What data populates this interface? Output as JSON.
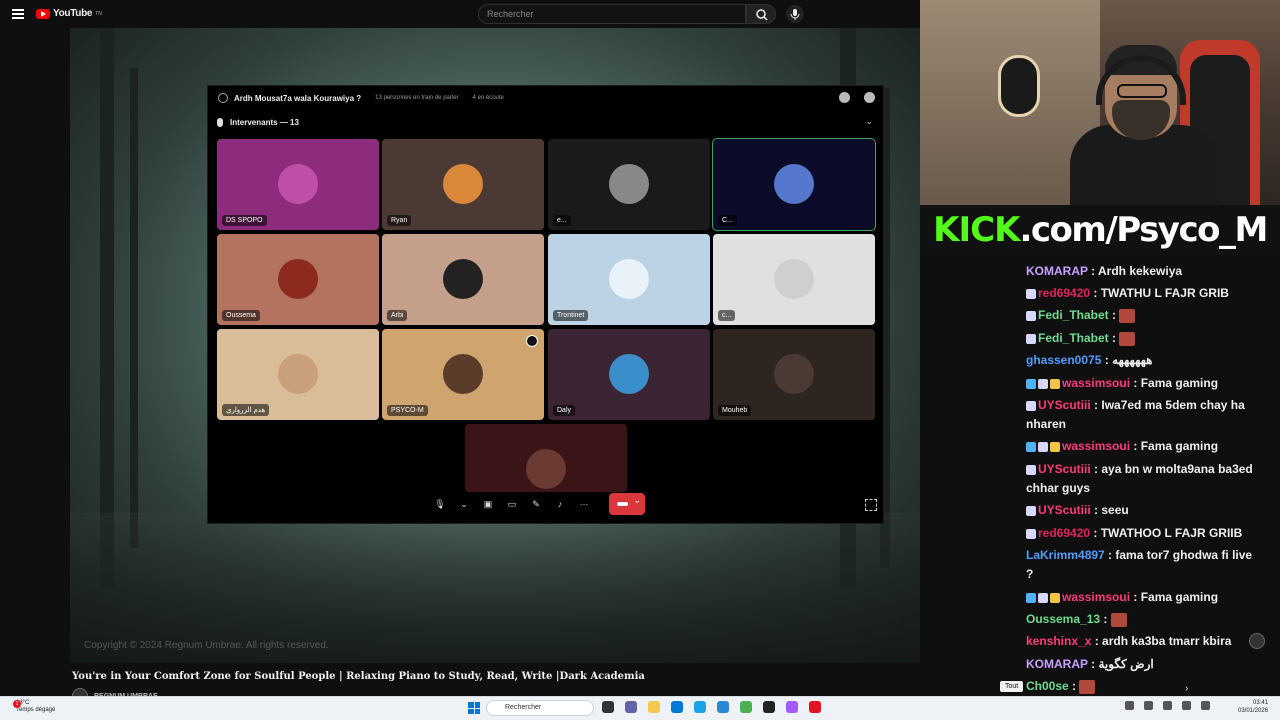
{
  "youtube": {
    "brand": "YouTube",
    "brand_suffix": "TN",
    "search_placeholder": "Rechercher",
    "video_title": "You're in Your Comfort Zone for Soulful People | Relaxing Piano to Study, Read, Write |Dark Academia",
    "channel_name": "REGNUM UMBRAE",
    "copyright": "Copyright © 2024 Regnum Umbrae. All rights reserved."
  },
  "discord": {
    "stage_title": "Ardh Mousat7a wala Kourawiya ?",
    "speaking_count": "13 personnes en train de parler",
    "listening_count": "4 en écoute",
    "speakers_header": "Intervenants — 13",
    "tiles": [
      {
        "name": "DS SPOPO",
        "bg": "#8d2b7c",
        "face": "#c04fa8"
      },
      {
        "name": "Ryan",
        "bg": "#4a3a33",
        "face": "#d9883a"
      },
      {
        "name": "e...",
        "bg": "#1a1a1c",
        "face": "#888888"
      },
      {
        "name": "C...",
        "bg": "#0b0b2a",
        "face": "#5577cc"
      },
      {
        "name": "Oussema",
        "bg": "#b4735e",
        "face": "#8c2a1e"
      },
      {
        "name": "Arbi",
        "bg": "#c4a08a",
        "face": "#222222"
      },
      {
        "name": "Trontinet",
        "bg": "#bcd3e6",
        "face": "#e9f1f9"
      },
      {
        "name": "c...",
        "bg": "#e0e0e0",
        "face": "#cfcfcf"
      },
      {
        "name": "هدم الزرواري",
        "bg": "#d8bd98",
        "face": "#c9a079"
      },
      {
        "name": "PSYCO-M",
        "bg": "#d0a46f",
        "face": "#5a3c2a"
      },
      {
        "name": "Daly",
        "bg": "#3a2434",
        "face": "#3b8ec9"
      },
      {
        "name": "Mouheb",
        "bg": "#2f2520",
        "face": "#4a3a33"
      },
      {
        "name": "",
        "bg": "#3a1416",
        "face": "#6a3a33"
      }
    ]
  },
  "stream": {
    "kick_prefix": "KICK",
    "kick_rest": ".com/Psyco_M"
  },
  "chat": {
    "messages": [
      {
        "user": "KOMARAP",
        "color": "#c9a0ff",
        "text": "Ardh kekewiya",
        "icons": []
      },
      {
        "user": "red69420",
        "color": "#e0245e",
        "text": "TWATHU L FAJR GRIB",
        "icons": [
          "#d7d7ff"
        ]
      },
      {
        "user": "Fedi_Thabet",
        "color": "#6ddc8f",
        "text": "",
        "icons": [
          "#d7d7ff"
        ],
        "emote": true
      },
      {
        "user": "Fedi_Thabet",
        "color": "#6ddc8f",
        "text": "",
        "icons": [
          "#d7d7ff"
        ],
        "emote": true
      },
      {
        "user": "ghassen0075",
        "color": "#4f9dff",
        "text": "ههههههه",
        "icons": []
      },
      {
        "user": "wassimsoui",
        "color": "#ff3b7a",
        "text": "Fama gaming",
        "icons": [
          "#4fb4ff",
          "#d7d7ff",
          "#f5c542"
        ]
      },
      {
        "user": "UYScutiii",
        "color": "#ff3b7a",
        "text": "Iwa7ed ma 5dem chay ha nharen",
        "icons": [
          "#d7d7ff"
        ]
      },
      {
        "user": "wassimsoui",
        "color": "#ff3b7a",
        "text": "Fama gaming",
        "icons": [
          "#4fb4ff",
          "#d7d7ff",
          "#f5c542"
        ]
      },
      {
        "user": "UYScutiii",
        "color": "#ff3b7a",
        "text": "aya bn w molta9ana ba3ed chhar guys",
        "icons": [
          "#d7d7ff"
        ]
      },
      {
        "user": "UYScutiii",
        "color": "#ff3b7a",
        "text": "seeu",
        "icons": [
          "#d7d7ff"
        ]
      },
      {
        "user": "red69420",
        "color": "#e0245e",
        "text": "TWATHOO L FAJR GRIIB",
        "icons": [
          "#d7d7ff"
        ]
      },
      {
        "user": "LaKrimm4897",
        "color": "#4f9dff",
        "text": "fama tor7 ghodwa fi live ?",
        "icons": []
      },
      {
        "user": "wassimsoui",
        "color": "#ff3b7a",
        "text": "Fama gaming",
        "icons": [
          "#4fb4ff",
          "#d7d7ff",
          "#f5c542"
        ]
      },
      {
        "user": "Oussema_13",
        "color": "#6ddc8f",
        "text": "",
        "icons": [],
        "emote": true
      },
      {
        "user": "kenshinx_x",
        "color": "#ff3b7a",
        "text": "ardh ka3ba tmarr kbira",
        "icons": []
      },
      {
        "user": "KOMARAP",
        "color": "#c9a0ff",
        "text": "ارض كگوية",
        "icons": []
      },
      {
        "user": "Ch00se",
        "color": "#6ddc8f",
        "text": "",
        "icons": [],
        "emote": true
      }
    ],
    "filter_label": "Tout"
  },
  "taskbar": {
    "temp": "13°C",
    "weather": "Temps dégagé",
    "notif": "1",
    "search_label": "Rechercher",
    "time": "03:41",
    "date": "03/01/2026",
    "app_colors": [
      "#333333",
      "#6264a7",
      "#f2c94c",
      "#0078d4",
      "#1ba2e4",
      "#2b88d8",
      "#4caf50",
      "#222222",
      "#a259ff",
      "#e81123"
    ]
  }
}
